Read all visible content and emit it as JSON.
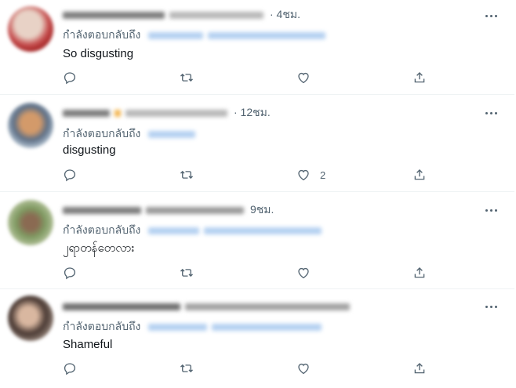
{
  "common": {
    "reply_label": "กำลังตอบกลับถึง"
  },
  "tweets": [
    {
      "time": "· 4ชม.",
      "text": "So disgusting",
      "like_count": "",
      "avatar_colors": [
        "#d8b4a8",
        "#b22a2a"
      ]
    },
    {
      "time": "· 12ชม.",
      "text": "disgusting",
      "like_count": "2",
      "avatar_colors": [
        "#8aa0b4",
        "#c98a5a"
      ]
    },
    {
      "time": "9ชม.",
      "text": "၂ရာတန်တေလား",
      "like_count": "",
      "avatar_colors": [
        "#9fae8a",
        "#6d7a55"
      ]
    },
    {
      "time": "",
      "text": "Shameful",
      "like_count": "",
      "avatar_colors": [
        "#6b5a52",
        "#c9a890"
      ]
    }
  ],
  "icons": [
    "reply-icon",
    "retweet-icon",
    "like-icon",
    "share-icon",
    "more-icon"
  ]
}
